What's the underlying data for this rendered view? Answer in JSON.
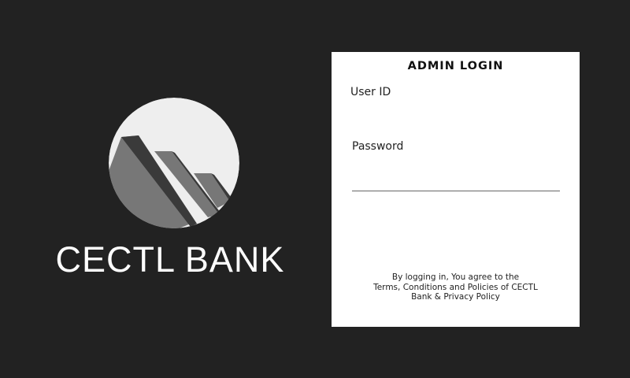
{
  "brand": {
    "name": "CECTL BANK",
    "logo_icon": "mountain-peaks-logo-icon"
  },
  "login": {
    "title": "ADMIN LOGIN",
    "user_id_label": "User ID",
    "user_id_value": "",
    "password_label": "Password",
    "password_value": "",
    "terms_lines": [
      "By logging in, You agree to the",
      "Terms, Conditions and Policies of CECTL",
      "Bank & Privacy Policy"
    ]
  },
  "colors": {
    "background": "#222222",
    "card": "#ffffff",
    "logo_circle": "#eeeeee",
    "logo_face_light": "#777777",
    "logo_face_dark": "#3a3a3a"
  }
}
